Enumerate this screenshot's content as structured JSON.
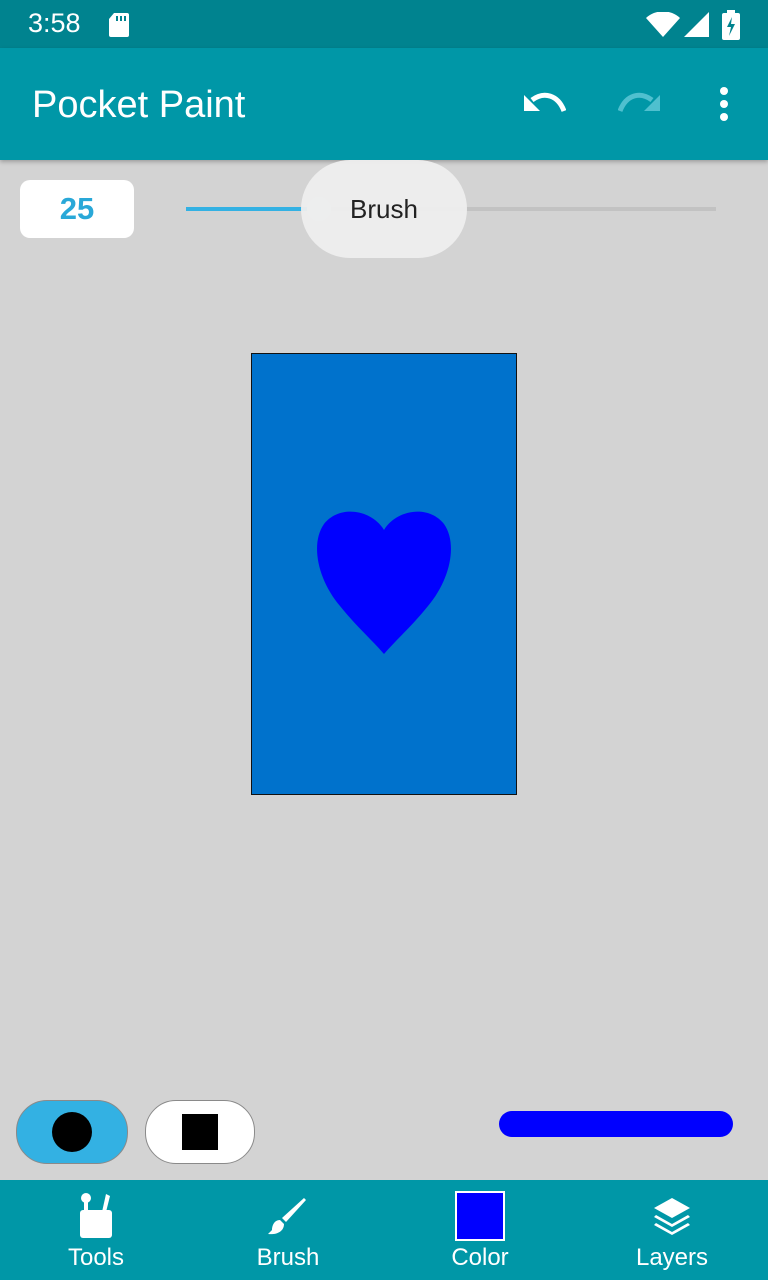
{
  "status": {
    "time": "3:58",
    "icons": [
      "sd-card-icon",
      "wifi-icon",
      "cell-signal-icon",
      "battery-charging-icon"
    ]
  },
  "appbar": {
    "title": "Pocket Paint",
    "actions": [
      "undo-icon",
      "redo-icon",
      "more-vert-icon"
    ]
  },
  "brush_size": {
    "value": "25",
    "slider_fraction": 0.25,
    "tooltip": "Brush"
  },
  "canvas": {
    "background_color": "#0072cc",
    "shape": "heart",
    "shape_color": "#0000ff"
  },
  "brush_options": {
    "cap_round_selected": true,
    "cap_square_selected": false,
    "preview_color": "#0000ff"
  },
  "bottom_nav": {
    "tools": "Tools",
    "brush": "Brush",
    "color": "Color",
    "layers": "Layers",
    "selected_color": "#0000ff"
  },
  "colors": {
    "status_bar": "#00838f",
    "app_bar": "#0097a7",
    "accent": "#33b1e3"
  }
}
